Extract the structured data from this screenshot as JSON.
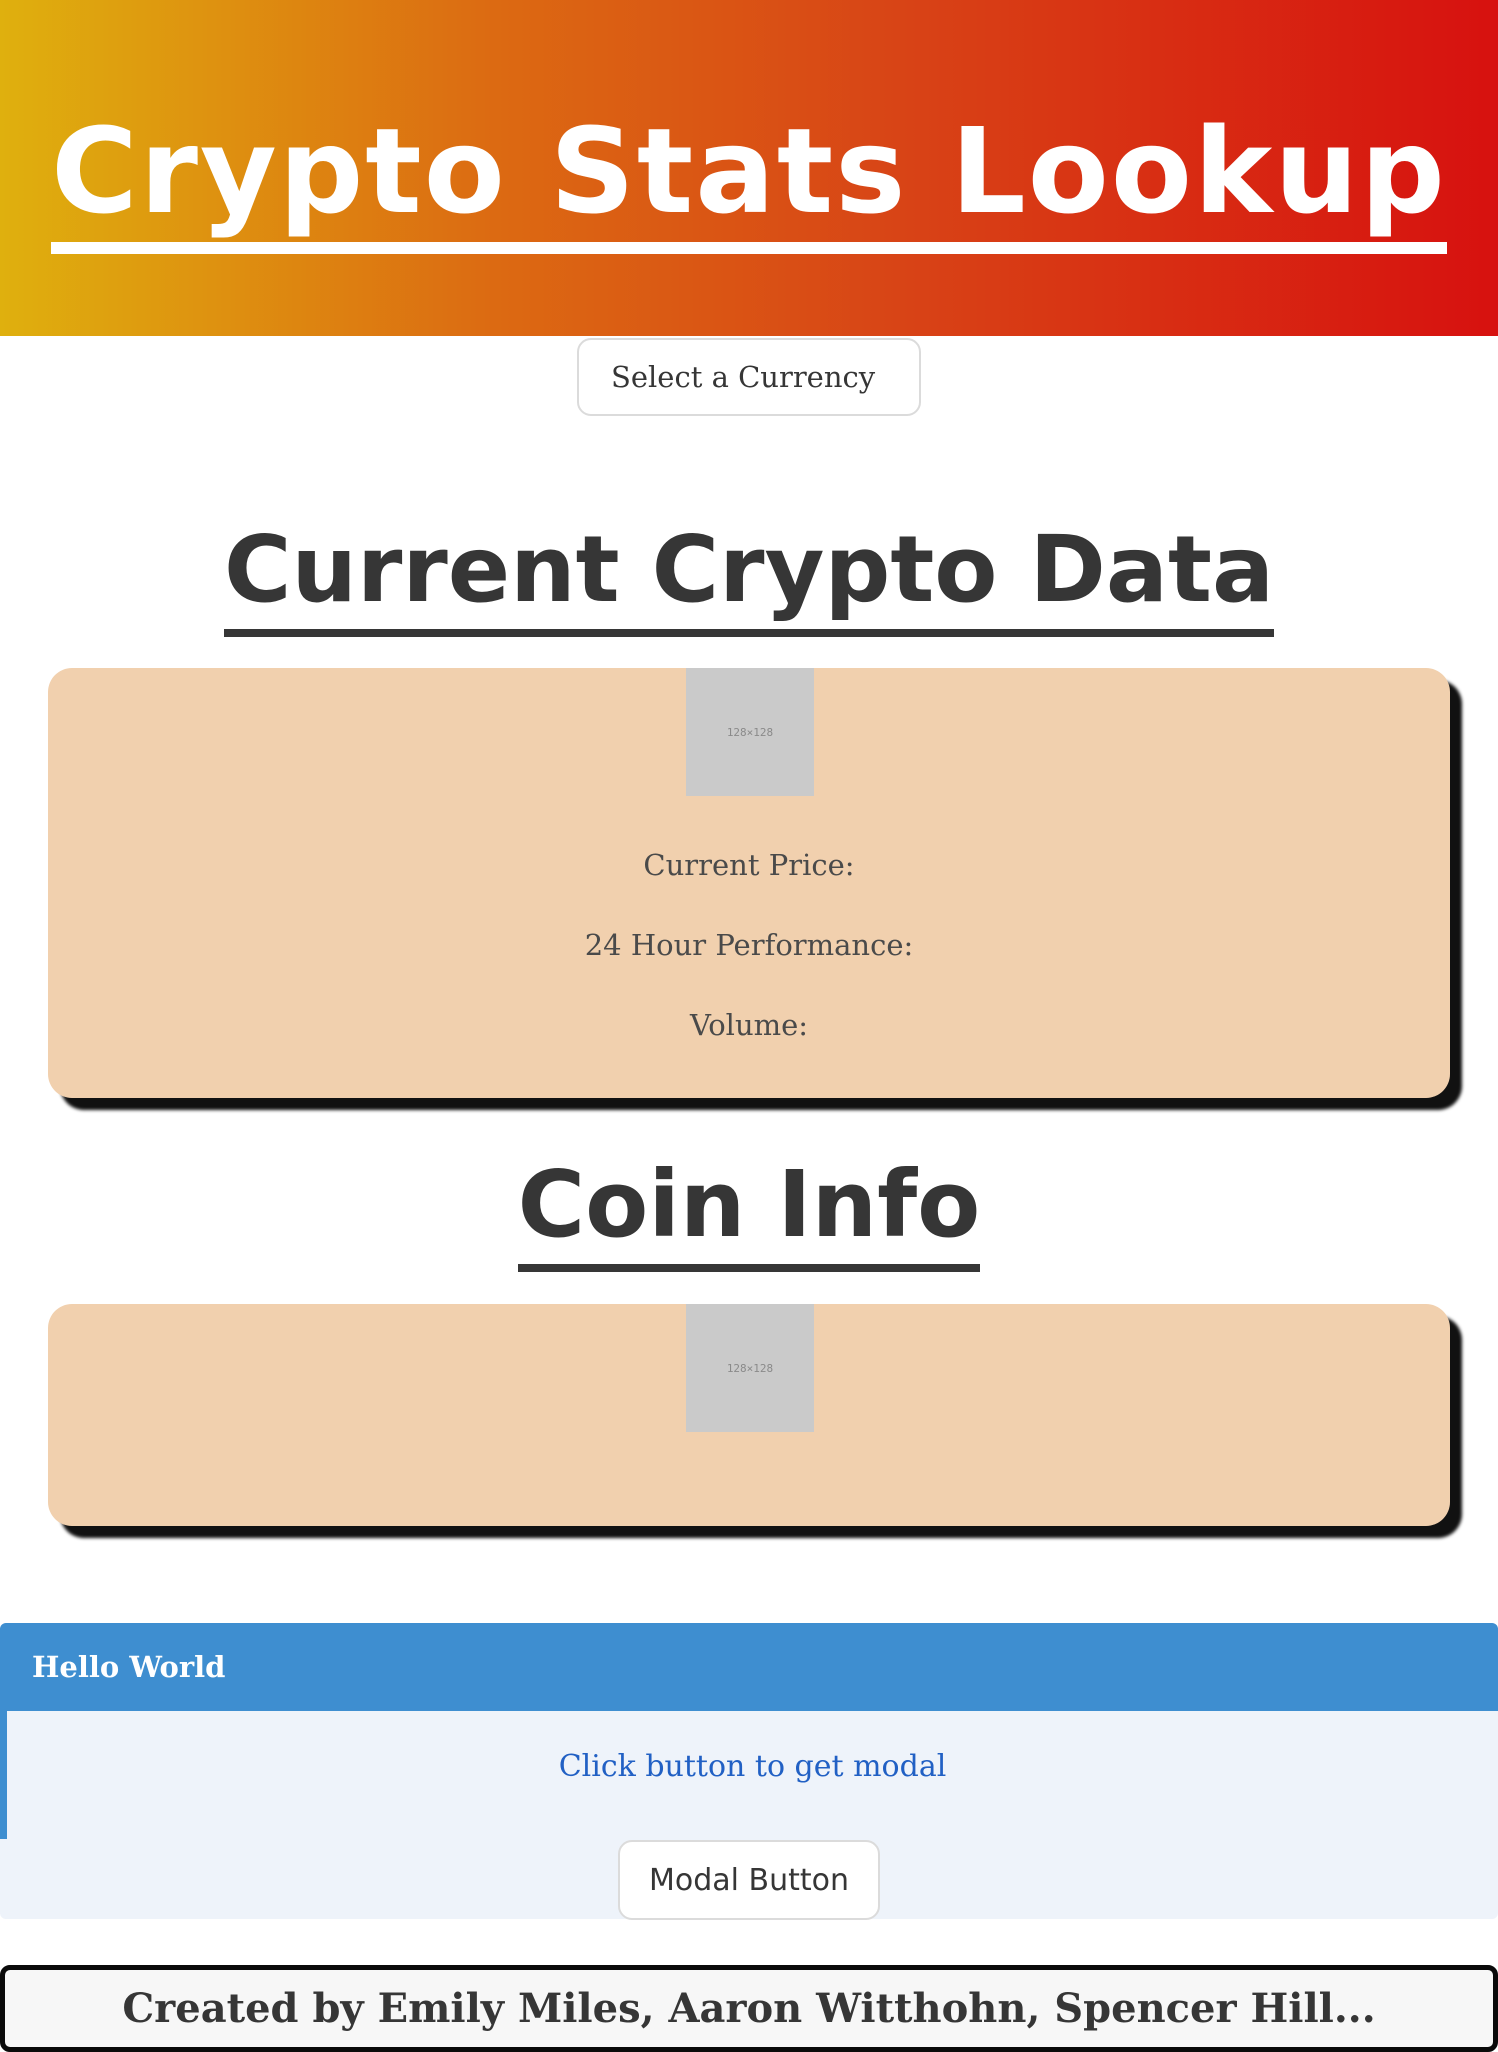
{
  "header": {
    "title": "Crypto Stats Lookup"
  },
  "currency_select": {
    "selected": "Select a Currency"
  },
  "current_section": {
    "heading": "Current Crypto Data",
    "image_placeholder": "128×128",
    "price_label": "Current Price:",
    "performance_label": "24 Hour Performance:",
    "volume_label": "Volume:"
  },
  "coin_section": {
    "heading": "Coin Info",
    "image_placeholder": "128×128"
  },
  "message": {
    "header": "Hello World",
    "body": "Click button to get modal",
    "button_label": "Modal Button"
  },
  "footer": {
    "credits": "Created by Emily Miles, Aaron Witthohn, Spencer Hill..."
  },
  "colors": {
    "gradient_start": "#dfb00e",
    "gradient_end": "#d7110f",
    "card_bg": "#f1d0ae",
    "info_blue": "#3e8ed0",
    "info_text": "#2160c4"
  }
}
